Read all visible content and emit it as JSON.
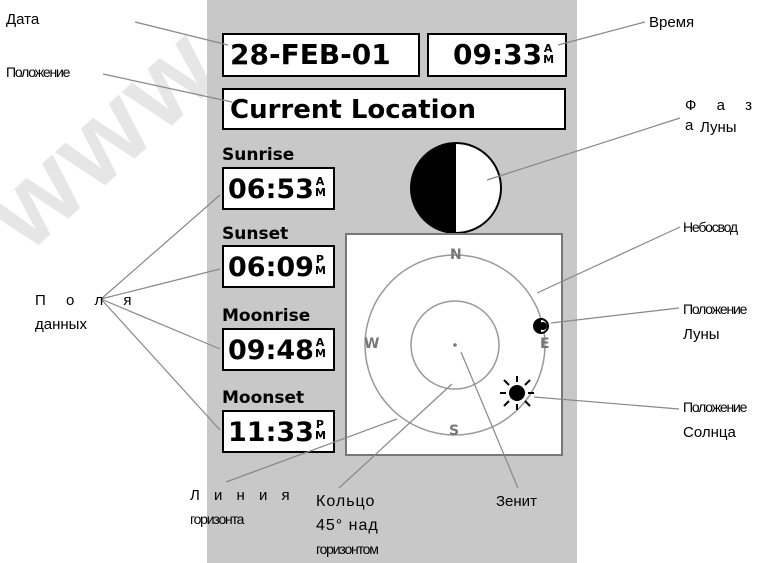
{
  "screen": {
    "date": "28-FEB-01",
    "time": "09:33",
    "time_ampm": [
      "A",
      "M"
    ],
    "location": "Current Location",
    "sunrise_label": "Sunrise",
    "sunrise_time": "06:53",
    "sunrise_ampm": [
      "A",
      "M"
    ],
    "sunset_label": "Sunset",
    "sunset_time": "06:09",
    "sunset_ampm": [
      "P",
      "M"
    ],
    "moonrise_label": "Moonrise",
    "moonrise_time": "09:48",
    "moonrise_ampm": [
      "A",
      "M"
    ],
    "moonset_label": "Moonset",
    "moonset_time": "11:33",
    "moonset_ampm": [
      "P",
      "M"
    ],
    "compass": {
      "n": "N",
      "s": "S",
      "e": "E",
      "w": "W"
    }
  },
  "annotations": {
    "date": "Дата",
    "position": "Положение",
    "time": "Время",
    "moon_phase_1": "Ф а з а",
    "moon_phase_2": "Луны",
    "sky": "Небосвод",
    "moon_pos_1": "Положение",
    "moon_pos_2": "Луны",
    "sun_pos_1": "Положение",
    "sun_pos_2": "Солнца",
    "data_fields_1": "П о л я",
    "data_fields_2": "данных",
    "horizon_1": "Л и н и я",
    "horizon_2": "горизонта",
    "ring_1": "Кольцо",
    "ring_2": "45° над",
    "ring_3": "горизонтом",
    "zenith": "Зенит"
  },
  "watermark": "www"
}
